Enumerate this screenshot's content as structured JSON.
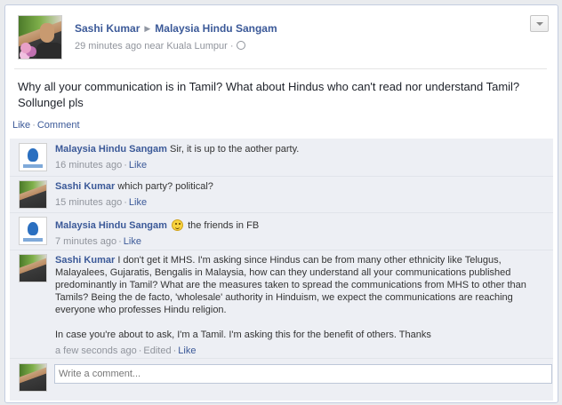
{
  "header": {
    "author": "Sashi Kumar",
    "arrow": "▶",
    "target": "Malaysia Hindu Sangam",
    "time": "29 minutes ago near Kuala Lumpur",
    "dot": "·"
  },
  "post": {
    "text": "Why all your communication is in Tamil? What about Hindus who can't read nor understand Tamil? Sollungel pls"
  },
  "actions": {
    "like": "Like",
    "sep": "·",
    "comment": "Comment"
  },
  "comments": [
    {
      "author": "Malaysia Hindu Sangam",
      "text": "Sir, it is up to the aother party.",
      "time": "16 minutes ago",
      "like": "Like"
    },
    {
      "author": "Sashi Kumar",
      "text": "which party? political?",
      "time": "15 minutes ago",
      "like": "Like"
    },
    {
      "author": "Malaysia Hindu Sangam",
      "text": "the friends in FB",
      "time": "7 minutes ago",
      "like": "Like"
    },
    {
      "author": "Sashi Kumar",
      "text1": "I don't get it MHS. I'm asking since Hindus can be from many other ethnicity like Telugus, Malayalees, Gujaratis, Bengalis in Malaysia, how can they understand all your communications published predominantly in Tamil? What are the measures taken to spread the communications from MHS to other than Tamils? Being the de facto, 'wholesale' authority in Hinduism, we expect the communications are reaching everyone who professes Hindu religion.",
      "text2": "In case you're about to ask, I'm a Tamil. I'm asking this for the benefit of others. Thanks",
      "time": "a few seconds ago",
      "edited": "Edited",
      "like": "Like"
    }
  ],
  "composer": {
    "placeholder": "Write a comment..."
  },
  "icons": {
    "globe": "globe-icon",
    "smiley": "smiley-icon",
    "chevron": "chevron-down-icon"
  }
}
